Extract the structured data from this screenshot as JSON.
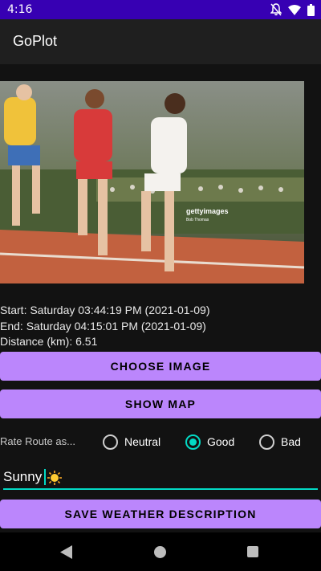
{
  "status_bar": {
    "time": "4:16",
    "icons": [
      "notifications-off-icon",
      "wifi-icon",
      "battery-icon"
    ]
  },
  "app_bar": {
    "title": "GoPlot"
  },
  "photo": {
    "subject": "runners-on-track",
    "watermark_brand": "gettyimages",
    "watermark_credit": "Bob Thomas"
  },
  "route_info": {
    "start": "Start: Saturday 03:44:19 PM (2021-01-09)",
    "end": "End: Saturday 04:15:01 PM (2021-01-09)",
    "distance": "Distance (km): 6.51"
  },
  "buttons": {
    "choose_image": "CHOOSE IMAGE",
    "show_map": "SHOW MAP",
    "save_weather": "SAVE WEATHER DESCRIPTION"
  },
  "rating": {
    "label": "Rate Route as...",
    "options": [
      {
        "label": "Neutral",
        "checked": false
      },
      {
        "label": "Good",
        "checked": true
      },
      {
        "label": "Bad",
        "checked": false
      }
    ]
  },
  "weather": {
    "value": "Sunny"
  },
  "colors": {
    "status_bar": "#3700b3",
    "primary_button": "#bb86fc",
    "accent": "#03dac5",
    "background": "#121212"
  },
  "nav_bar": {
    "icons": [
      "back-icon",
      "home-icon",
      "recents-icon"
    ]
  }
}
